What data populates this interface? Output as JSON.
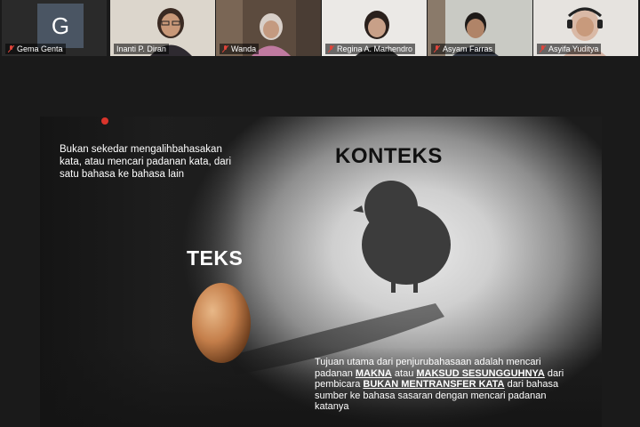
{
  "participants": [
    {
      "name": "Gema Genta",
      "initial": "G"
    },
    {
      "name": "Inanti P. Diran"
    },
    {
      "name": "Wanda"
    },
    {
      "name": "Regina A. Marhendro"
    },
    {
      "name": "Asyam Farras"
    },
    {
      "name": "Asyifa Yuditya"
    }
  ],
  "slide": {
    "intro": "Bukan sekedar mengalihbahasakan kata, atau mencari padanan kata, dari satu bahasa ke bahasa lain",
    "konteks": "KONTEKS",
    "teks": "TEKS",
    "goal": {
      "p1": "Tujuan utama dari penjurubahasaan adalah mencari padanan ",
      "b1": "MAKNA",
      "p2": " atau ",
      "b2": "MAKSUD SESUNGGUHNYA",
      "p3": " dari pembicara ",
      "b3": "BUKAN MENTRANSFER KATA",
      "p4": " dari bahasa sumber ke bahasa sasaran dengan mencari padanan katanya"
    }
  },
  "colors": {
    "mic_muted": "#e0443a",
    "avatar_bg": "#4a5563",
    "rec": "#d9342b"
  }
}
